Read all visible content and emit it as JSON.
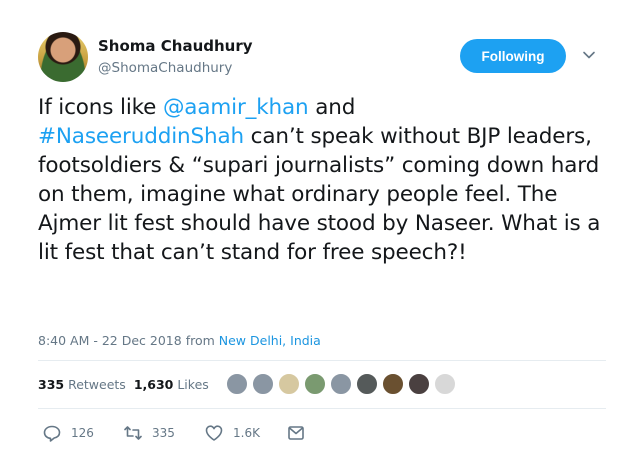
{
  "author": {
    "name": "Shoma Chaudhury",
    "handle": "@ShomaChaudhury"
  },
  "follow_button": {
    "label": "Following"
  },
  "tweet": {
    "before_mention": "If icons like ",
    "mention": "@aamir_khan",
    "after_mention": " and",
    "hashtag": "#NaseeruddinShah",
    "after_hashtag": " can’t speak without BJP leaders, footsoldiers & “supari journalists” coming down hard on them, imagine what ordinary people feel. The Ajmer lit fest should have stood by Naseer. What is a lit fest that can’t stand for free speech?!"
  },
  "meta": {
    "timestamp": "8:40 AM - 22 Dec 2018",
    "from": "from",
    "location": "New Delhi, India"
  },
  "stats": {
    "retweets_count": "335",
    "retweets_label": "Retweets",
    "likes_count": "1,630",
    "likes_label": "Likes"
  },
  "liker_avatars": [
    {
      "color": "#8a96a3"
    },
    {
      "color": "#8a96a3"
    },
    {
      "color": "#d6c8a0"
    },
    {
      "color": "#7a9a70"
    },
    {
      "color": "#8a96a3"
    },
    {
      "color": "#555a5a"
    },
    {
      "color": "#6a5030"
    },
    {
      "color": "#4a4040"
    },
    {
      "color": "#d8d8d8"
    }
  ],
  "actions": {
    "reply_count": "126",
    "retweet_count": "335",
    "like_count": "1.6K"
  },
  "colors": {
    "accent": "#1da1f2",
    "text": "#14171a",
    "muted": "#657786"
  }
}
